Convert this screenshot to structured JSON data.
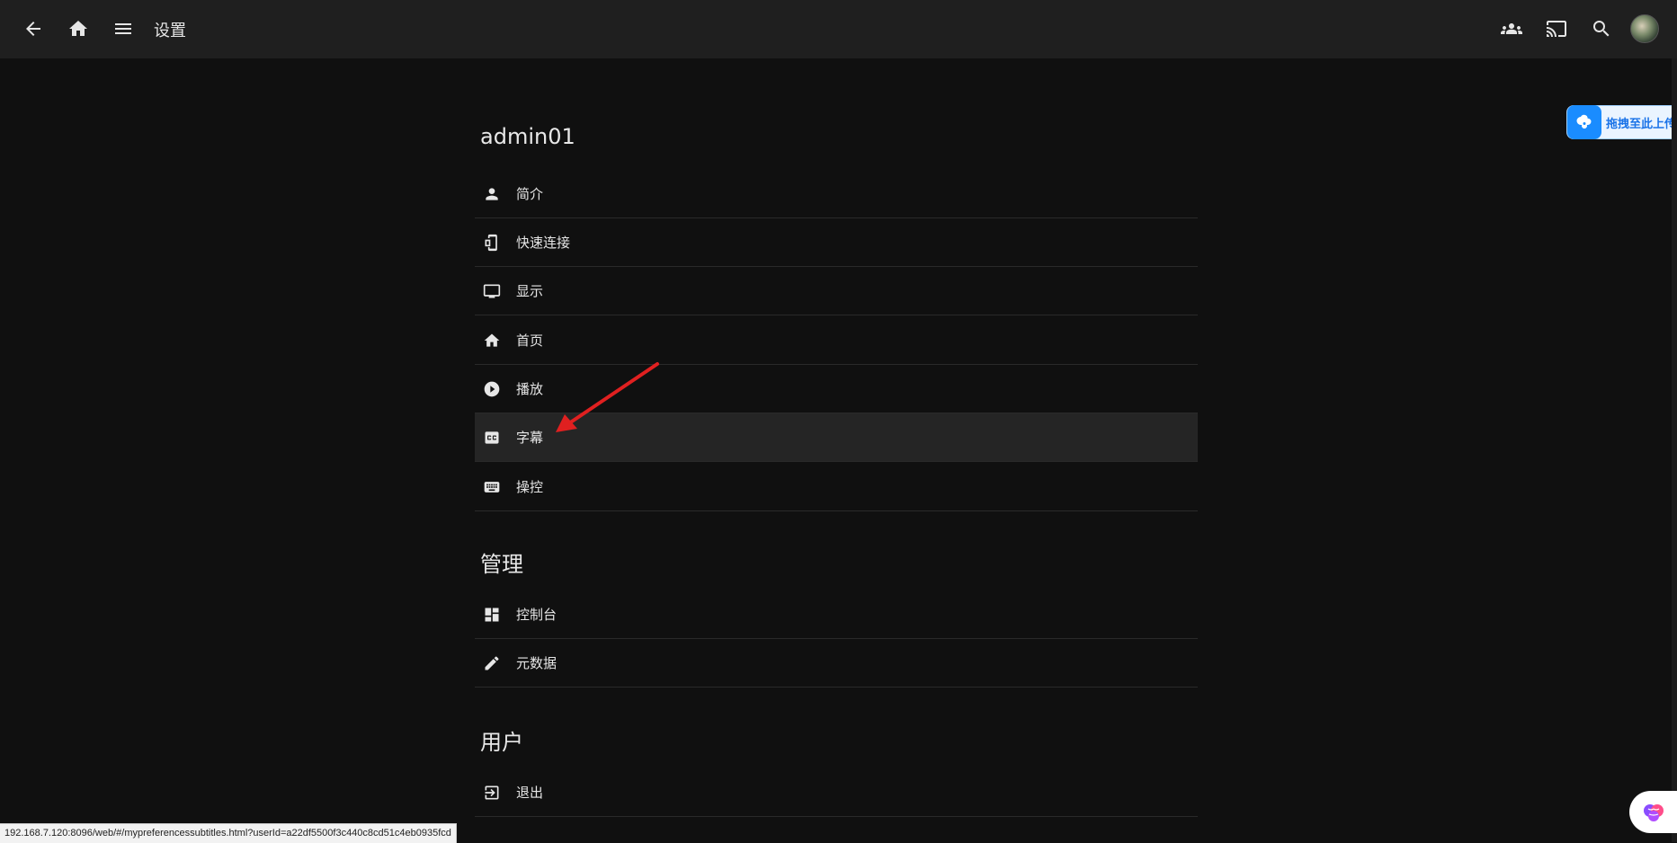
{
  "header": {
    "title": "设置",
    "icons": [
      "back-arrow-icon",
      "home-icon",
      "menu-icon",
      "users-icon",
      "cast-icon",
      "search-icon"
    ]
  },
  "user_section": {
    "title": "admin01",
    "items": [
      {
        "label": "简介",
        "icon": "person-icon"
      },
      {
        "label": "快速连接",
        "icon": "phone-link-icon"
      },
      {
        "label": "显示",
        "icon": "monitor-icon"
      },
      {
        "label": "首页",
        "icon": "home-icon"
      },
      {
        "label": "播放",
        "icon": "play-circle-icon"
      },
      {
        "label": "字幕",
        "icon": "closed-caption-icon",
        "active": true
      },
      {
        "label": "操控",
        "icon": "keyboard-icon"
      }
    ]
  },
  "admin_section": {
    "title": "管理",
    "items": [
      {
        "label": "控制台",
        "icon": "dashboard-icon"
      },
      {
        "label": "元数据",
        "icon": "pencil-icon"
      }
    ]
  },
  "users_section": {
    "title": "用户",
    "items": [
      {
        "label": "退出",
        "icon": "logout-icon"
      }
    ]
  },
  "upload_widget": {
    "text": "拖拽至此上传"
  },
  "status_bar": {
    "url": "192.168.7.120:8096/web/#/mypreferencessubtitles.html?userId=a22df5500f3c440c8cd51c4eb0935fcd"
  },
  "colors": {
    "background": "#101010",
    "header": "#1f1f1f",
    "active_row": "#252525",
    "annotation_arrow": "#e02020",
    "upload_blue": "#1a8cff"
  }
}
